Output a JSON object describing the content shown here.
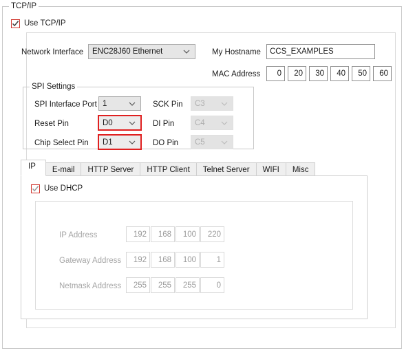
{
  "group": {
    "title": "TCP/IP",
    "use_tcpip": {
      "label": "Use TCP/IP",
      "checked": true
    }
  },
  "network": {
    "interface_label": "Network Interface",
    "interface_value": "ENC28J60 Ethernet",
    "hostname_label": "My Hostname",
    "hostname_value": "CCS_EXAMPLES",
    "mac_label": "MAC Address",
    "mac_octets": [
      "0",
      "20",
      "30",
      "40",
      "50",
      "60"
    ]
  },
  "spi": {
    "title": "SPI Settings",
    "rows": [
      {
        "left_label": "SPI Interface Port",
        "left_value": "1",
        "right_label": "SCK Pin",
        "right_value": "C3"
      },
      {
        "left_label": "Reset Pin",
        "left_value": "D0",
        "right_label": "DI Pin",
        "right_value": "C4"
      },
      {
        "left_label": "Chip Select Pin",
        "left_value": "D1",
        "right_label": "DO Pin",
        "right_value": "C5"
      }
    ]
  },
  "tabs": {
    "items": [
      {
        "label": "IP",
        "active": true
      },
      {
        "label": "E-mail",
        "active": false
      },
      {
        "label": "HTTP Server",
        "active": false
      },
      {
        "label": "HTTP Client",
        "active": false
      },
      {
        "label": "Telnet Server",
        "active": false
      },
      {
        "label": "WIFI",
        "active": false
      },
      {
        "label": "Misc",
        "active": false
      }
    ]
  },
  "ip_tab": {
    "use_dhcp": {
      "label": "Use DHCP",
      "checked": true
    },
    "rows": [
      {
        "label": "IP Address",
        "octets": [
          "192",
          "168",
          "100",
          "220"
        ]
      },
      {
        "label": "Gateway Address",
        "octets": [
          "192",
          "168",
          "100",
          "1"
        ]
      },
      {
        "label": "Netmask Address",
        "octets": [
          "255",
          "255",
          "255",
          "0"
        ]
      }
    ]
  },
  "colors": {
    "accent_red": "#d0342c",
    "focus_red": "#e02020",
    "border_gray": "#c8c8c8",
    "disabled_text": "#a6a6a6"
  }
}
